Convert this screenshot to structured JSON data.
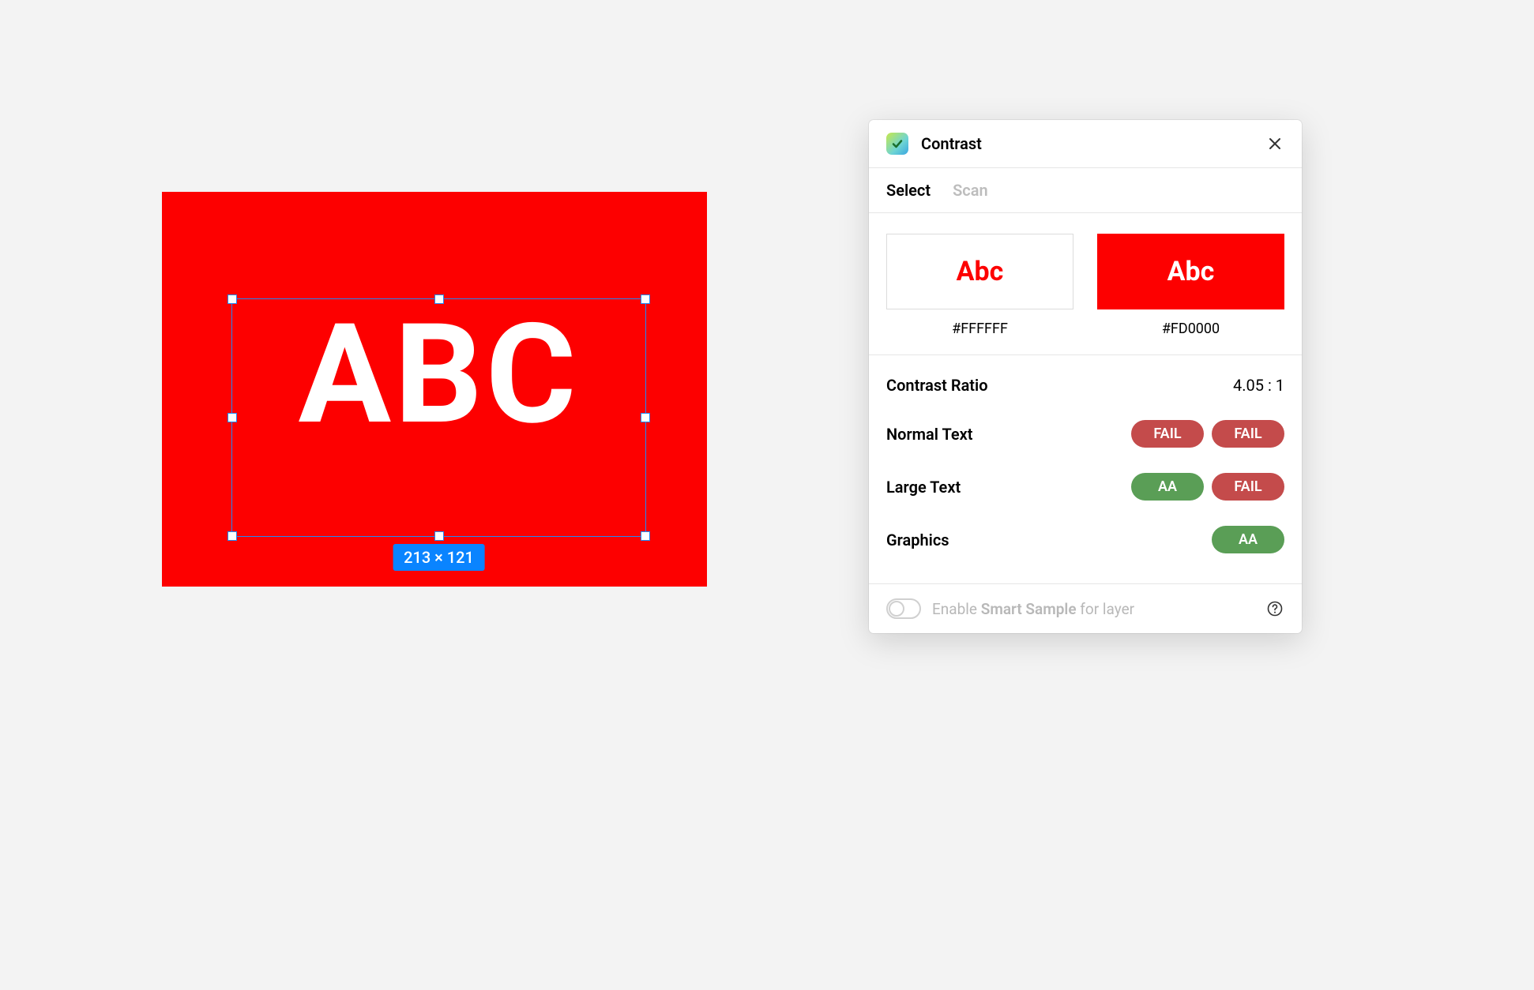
{
  "canvas": {
    "text": "ABC",
    "selection_size": "213 × 121",
    "bg_color": "#FD0000",
    "fg_color": "#FFFFFF"
  },
  "panel": {
    "title": "Contrast",
    "tabs": {
      "select": "Select",
      "scan": "Scan"
    },
    "swatch": {
      "sample_text": "Abc",
      "fg_hex": "#FFFFFF",
      "bg_hex": "#FD0000"
    },
    "results": {
      "ratio_label": "Contrast Ratio",
      "ratio_value": "4.05 : 1",
      "normal_text_label": "Normal Text",
      "normal_text_aa": "FAIL",
      "normal_text_aaa": "FAIL",
      "large_text_label": "Large Text",
      "large_text_aa": "AA",
      "large_text_aaa": "FAIL",
      "graphics_label": "Graphics",
      "graphics_aa": "AA"
    },
    "footer": {
      "prefix": "Enable ",
      "bold": "Smart Sample",
      "suffix": " for layer"
    }
  }
}
